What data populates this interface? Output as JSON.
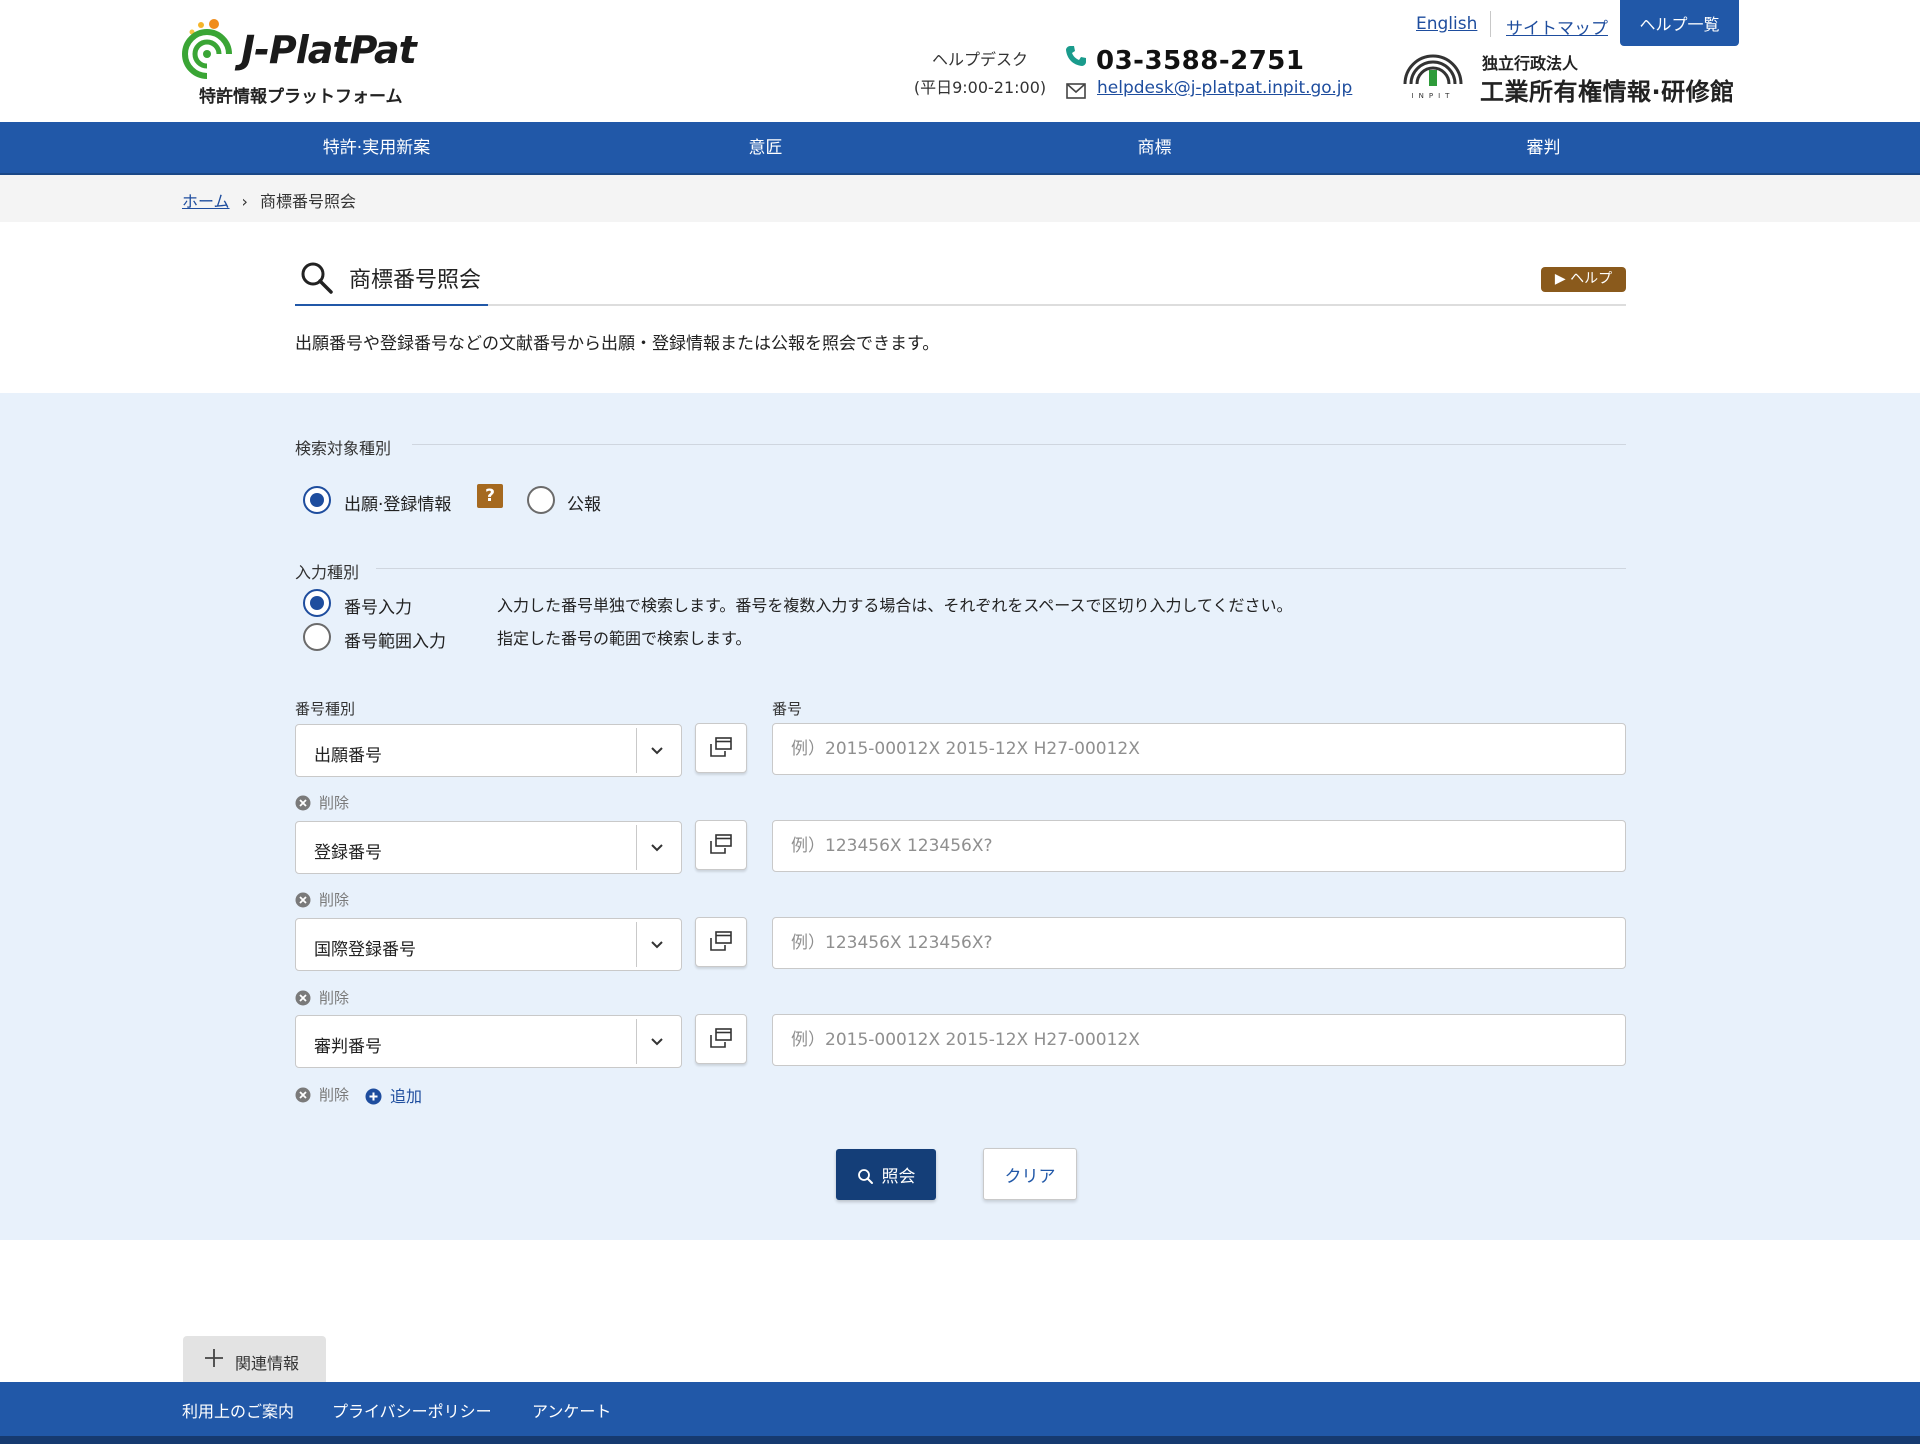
{
  "header": {
    "logo_text": "J-PlatPat",
    "logo_subtitle": "特許情報プラットフォーム",
    "helpdesk_label": "ヘルプデスク",
    "helpdesk_hours": "(平日9:00-21:00)",
    "phone": "03-3588-2751",
    "email": "helpdesk@j-platpat.inpit.go.jp",
    "link_english": "English",
    "link_sitemap": "サイトマップ",
    "help_list": "ヘルプ一覧",
    "inpit_small": "独立行政法人",
    "inpit_name": "工業所有権情報·研修館",
    "inpit_logo_text": "INPIT"
  },
  "nav": {
    "items": [
      {
        "label": "特許·実用新案"
      },
      {
        "label": "意匠"
      },
      {
        "label": "商標"
      },
      {
        "label": "審判"
      }
    ]
  },
  "breadcrumb": {
    "home": "ホーム",
    "separator": "›",
    "current": "商標番号照会"
  },
  "page": {
    "title": "商標番号照会",
    "help_button": "▶ ヘルプ",
    "description": "出願番号や登録番号などの文献番号から出願・登録情報または公報を照会できます。"
  },
  "search_target": {
    "legend": "検索対象種別",
    "options": [
      {
        "label": "出願·登録情報",
        "checked": true
      },
      {
        "label": "公報",
        "checked": false
      }
    ],
    "help_badge": "?"
  },
  "input_mode": {
    "legend": "入力種別",
    "options": [
      {
        "label": "番号入力",
        "checked": true,
        "description": "入力した番号単独で検索します。番号を複数入力する場合は、それぞれをスペースで区切り入力してください。"
      },
      {
        "label": "番号範囲入力",
        "checked": false,
        "description": "指定した番号の範囲で検索します。"
      }
    ]
  },
  "number_form": {
    "type_label": "番号種別",
    "number_label": "番号",
    "rows": [
      {
        "type": "出願番号",
        "placeholder": "例）2015-00012X 2015-12X H27-00012X",
        "delete_label": "削除"
      },
      {
        "type": "登録番号",
        "placeholder": "例）123456X 123456X?",
        "delete_label": "削除"
      },
      {
        "type": "国際登録番号",
        "placeholder": "例）123456X 123456X?",
        "delete_label": "削除"
      },
      {
        "type": "審判番号",
        "placeholder": "例）2015-00012X 2015-12X H27-00012X",
        "delete_label": "削除"
      }
    ],
    "add_label": "追加"
  },
  "actions": {
    "search": "照会",
    "clear": "クリア"
  },
  "related": {
    "label": "関連情報"
  },
  "footer": {
    "links": [
      "利用上のご案内",
      "プライバシーポリシー",
      "アンケート"
    ]
  },
  "colors": {
    "primary": "#2158a8",
    "search_button": "#143e78",
    "panel_background": "#e8f1fb",
    "help_badge": "#8a5a1c"
  }
}
